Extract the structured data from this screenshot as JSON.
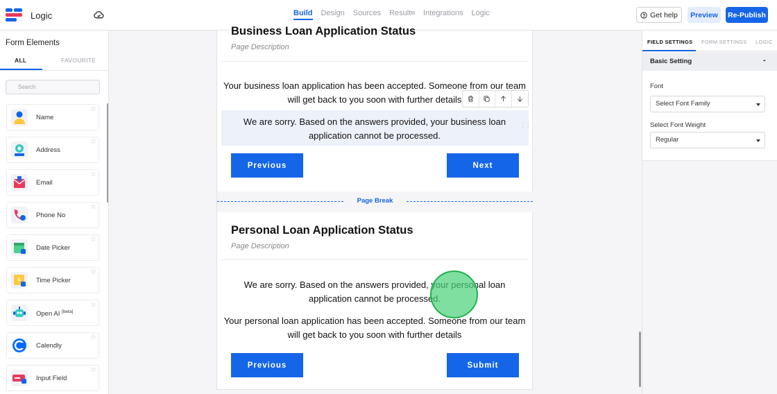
{
  "app": {
    "title": "Logic"
  },
  "nav": {
    "items": [
      {
        "label": "Build",
        "active": true
      },
      {
        "label": "Design",
        "active": false
      },
      {
        "label": "Sources",
        "active": false
      },
      {
        "label": "Result",
        "active": false,
        "external": true
      },
      {
        "label": "Integrations",
        "active": false
      },
      {
        "label": "Logic",
        "active": false
      }
    ]
  },
  "actions": {
    "help": "Get help",
    "preview": "Preview",
    "republish": "Re-Publish"
  },
  "sidebar": {
    "title": "Form Elements",
    "tabs": {
      "all": "ALL",
      "favourite": "FAVOURITE"
    },
    "search_placeholder": "Search",
    "items": [
      {
        "label": "Name",
        "icon": "person-icon"
      },
      {
        "label": "Address",
        "icon": "address-icon"
      },
      {
        "label": "Email",
        "icon": "email-icon"
      },
      {
        "label": "Phone No",
        "icon": "phone-icon"
      },
      {
        "label": "Date Picker",
        "icon": "calendar-icon"
      },
      {
        "label": "Time Picker",
        "icon": "clock-icon"
      },
      {
        "label": "Open AI",
        "badge": "[beta]",
        "icon": "robot-icon"
      },
      {
        "label": "Calendly",
        "icon": "calendly-icon"
      },
      {
        "label": "Input Field",
        "icon": "input-field-icon"
      }
    ]
  },
  "form": {
    "section1": {
      "title": "Business Loan Application Status",
      "description": "Page Description",
      "accepted": "Your business loan application has been accepted. Someone from our team will get back to you soon with further details",
      "rejected": "We are sorry. Based on the answers provided, your business loan application cannot be processed.",
      "prev": "Previous",
      "next": "Next"
    },
    "page_break": "Page Break",
    "section2": {
      "title": "Personal Loan Application Status",
      "description": "Page Description",
      "rejected": "We are sorry. Based on the answers provided, your personal loan application cannot be processed.",
      "accepted": "Your personal loan application has been accepted. Someone from our team will get back to you soon with further details",
      "prev": "Previous",
      "submit": "Submit"
    }
  },
  "right_panel": {
    "tabs": [
      "FIELD SETTINGS",
      "FORM SETTINGS",
      "LOGIC"
    ],
    "section": "Basic Setting",
    "collapse": "-",
    "font_label": "Font",
    "font_value": "Select Font Family",
    "weight_label": "Select Font Weight",
    "weight_value": "Regular"
  },
  "colors": {
    "accent": "#1565e8",
    "cursor": "#48d278"
  }
}
